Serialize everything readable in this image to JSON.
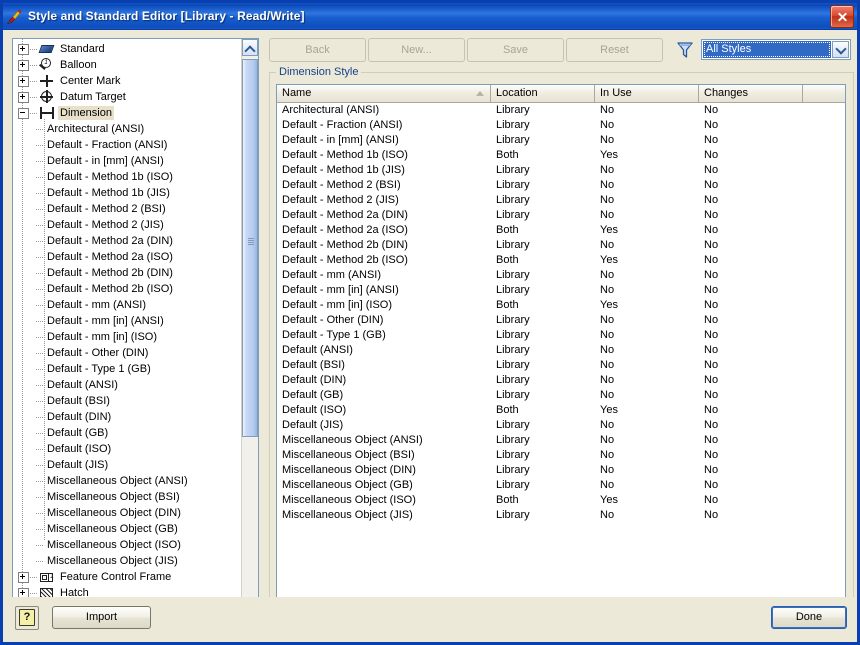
{
  "window": {
    "title": "Style and Standard Editor [Library - Read/Write]",
    "app_icon": "style-editor-icon",
    "close_icon": "close-icon"
  },
  "tree": {
    "roots": [
      {
        "label": "Standard",
        "icon": "book-icon",
        "expander": "plus"
      },
      {
        "label": "Balloon",
        "icon": "balloon-icon",
        "expander": "plus"
      },
      {
        "label": "Center Mark",
        "icon": "center-mark-icon",
        "expander": "plus"
      },
      {
        "label": "Datum Target",
        "icon": "datum-target-icon",
        "expander": "plus"
      },
      {
        "label": "Dimension",
        "icon": "dimension-icon",
        "expander": "minus",
        "selected": true
      }
    ],
    "children": [
      "Architectural (ANSI)",
      "Default - Fraction (ANSI)",
      "Default - in [mm] (ANSI)",
      "Default - Method 1b (ISO)",
      "Default - Method 1b (JIS)",
      "Default - Method 2 (BSI)",
      "Default - Method 2 (JIS)",
      "Default - Method 2a (DIN)",
      "Default - Method 2a (ISO)",
      "Default - Method 2b (DIN)",
      "Default - Method 2b (ISO)",
      "Default - mm (ANSI)",
      "Default - mm [in] (ANSI)",
      "Default - mm [in] (ISO)",
      "Default - Other (DIN)",
      "Default - Type 1 (GB)",
      "Default (ANSI)",
      "Default (BSI)",
      "Default (DIN)",
      "Default (GB)",
      "Default (ISO)",
      "Default (JIS)",
      "Miscellaneous Object (ANSI)",
      "Miscellaneous Object (BSI)",
      "Miscellaneous Object (DIN)",
      "Miscellaneous Object (GB)",
      "Miscellaneous Object (ISO)",
      "Miscellaneous Object (JIS)"
    ],
    "tail_roots": [
      {
        "label": "Feature Control Frame",
        "icon": "feature-control-frame-icon",
        "expander": "plus"
      },
      {
        "label": "Hatch",
        "icon": "hatch-icon",
        "expander": "plus"
      }
    ],
    "scrollbar": {
      "up_icon": "chevron-up-icon",
      "down_icon": "chevron-down-icon"
    }
  },
  "toolbar": {
    "back_label": "Back",
    "new_label": "New...",
    "save_label": "Save",
    "reset_label": "Reset",
    "filter_icon": "filter-funnel-icon",
    "filter_value": "All Styles",
    "filter_dropdown_icon": "chevron-down-icon"
  },
  "group": {
    "legend": "Dimension Style"
  },
  "table": {
    "columns": [
      "Name",
      "Location",
      "In Use",
      "Changes",
      ""
    ],
    "sort_column": "Name",
    "sort_direction": "ascending",
    "rows": [
      {
        "name": "Architectural (ANSI)",
        "location": "Library",
        "in_use": "No",
        "changes": "No"
      },
      {
        "name": "Default - Fraction (ANSI)",
        "location": "Library",
        "in_use": "No",
        "changes": "No"
      },
      {
        "name": "Default - in [mm] (ANSI)",
        "location": "Library",
        "in_use": "No",
        "changes": "No"
      },
      {
        "name": "Default - Method 1b (ISO)",
        "location": "Both",
        "in_use": "Yes",
        "changes": "No"
      },
      {
        "name": "Default - Method 1b (JIS)",
        "location": "Library",
        "in_use": "No",
        "changes": "No"
      },
      {
        "name": "Default - Method 2 (BSI)",
        "location": "Library",
        "in_use": "No",
        "changes": "No"
      },
      {
        "name": "Default - Method 2 (JIS)",
        "location": "Library",
        "in_use": "No",
        "changes": "No"
      },
      {
        "name": "Default - Method 2a (DIN)",
        "location": "Library",
        "in_use": "No",
        "changes": "No"
      },
      {
        "name": "Default - Method 2a (ISO)",
        "location": "Both",
        "in_use": "Yes",
        "changes": "No"
      },
      {
        "name": "Default - Method 2b (DIN)",
        "location": "Library",
        "in_use": "No",
        "changes": "No"
      },
      {
        "name": "Default - Method 2b (ISO)",
        "location": "Both",
        "in_use": "Yes",
        "changes": "No"
      },
      {
        "name": "Default - mm (ANSI)",
        "location": "Library",
        "in_use": "No",
        "changes": "No"
      },
      {
        "name": "Default - mm [in] (ANSI)",
        "location": "Library",
        "in_use": "No",
        "changes": "No"
      },
      {
        "name": "Default - mm [in] (ISO)",
        "location": "Both",
        "in_use": "Yes",
        "changes": "No"
      },
      {
        "name": "Default - Other (DIN)",
        "location": "Library",
        "in_use": "No",
        "changes": "No"
      },
      {
        "name": "Default - Type 1 (GB)",
        "location": "Library",
        "in_use": "No",
        "changes": "No"
      },
      {
        "name": "Default (ANSI)",
        "location": "Library",
        "in_use": "No",
        "changes": "No"
      },
      {
        "name": "Default (BSI)",
        "location": "Library",
        "in_use": "No",
        "changes": "No"
      },
      {
        "name": "Default (DIN)",
        "location": "Library",
        "in_use": "No",
        "changes": "No"
      },
      {
        "name": "Default (GB)",
        "location": "Library",
        "in_use": "No",
        "changes": "No"
      },
      {
        "name": "Default (ISO)",
        "location": "Both",
        "in_use": "Yes",
        "changes": "No"
      },
      {
        "name": "Default (JIS)",
        "location": "Library",
        "in_use": "No",
        "changes": "No"
      },
      {
        "name": "Miscellaneous Object (ANSI)",
        "location": "Library",
        "in_use": "No",
        "changes": "No"
      },
      {
        "name": "Miscellaneous Object (BSI)",
        "location": "Library",
        "in_use": "No",
        "changes": "No"
      },
      {
        "name": "Miscellaneous Object (DIN)",
        "location": "Library",
        "in_use": "No",
        "changes": "No"
      },
      {
        "name": "Miscellaneous Object (GB)",
        "location": "Library",
        "in_use": "No",
        "changes": "No"
      },
      {
        "name": "Miscellaneous Object (ISO)",
        "location": "Both",
        "in_use": "Yes",
        "changes": "No"
      },
      {
        "name": "Miscellaneous Object (JIS)",
        "location": "Library",
        "in_use": "No",
        "changes": "No"
      }
    ]
  },
  "footer": {
    "help_label": "?",
    "import_label": "Import",
    "done_label": "Done"
  },
  "colors": {
    "title_bar": "#1058c8",
    "dialog_face": "#ece9d8",
    "legend_text": "#15428b",
    "selection": "#316ac5",
    "tree_selection": "#e8e0c8"
  }
}
